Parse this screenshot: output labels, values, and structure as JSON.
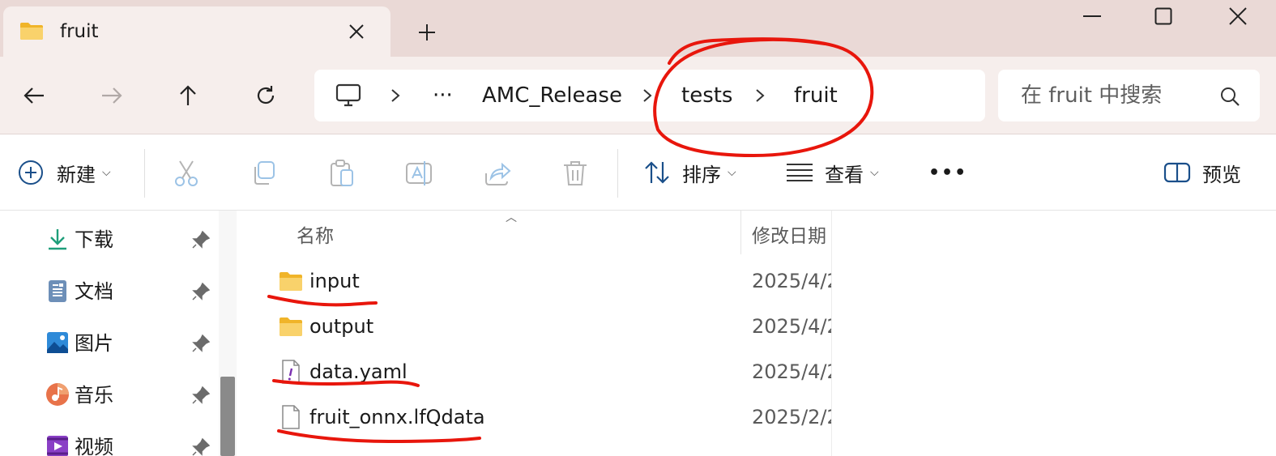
{
  "window": {
    "tab_title": "fruit",
    "new_tab_icon": "plus-icon",
    "minimize_icon": "minimize-icon",
    "maximize_icon": "maximize-icon",
    "close_icon": "close-icon"
  },
  "address_bar": {
    "root_icon": "computer-icon",
    "overflow": "···",
    "crumbs": [
      "AMC_Release",
      "tests",
      "fruit"
    ],
    "separator": ">"
  },
  "search": {
    "placeholder": "在 fruit 中搜索"
  },
  "toolbar": {
    "new_label": "新建",
    "sort_label": "排序",
    "view_label": "查看",
    "more_label": "•••",
    "preview_label": "预览",
    "disabled_actions": [
      "cut-icon",
      "copy-icon",
      "paste-icon",
      "rename-icon",
      "share-icon",
      "delete-icon"
    ]
  },
  "sidebar": {
    "items": [
      {
        "label": "下载",
        "icon": "download-icon"
      },
      {
        "label": "文档",
        "icon": "documents-icon"
      },
      {
        "label": "图片",
        "icon": "pictures-icon"
      },
      {
        "label": "音乐",
        "icon": "music-icon"
      },
      {
        "label": "视频",
        "icon": "videos-icon"
      }
    ]
  },
  "file_list": {
    "columns": [
      "名称",
      "修改日期"
    ],
    "rows": [
      {
        "name": "input",
        "type": "folder",
        "date": "2025/4/2"
      },
      {
        "name": "output",
        "type": "folder",
        "date": "2025/4/2"
      },
      {
        "name": "data.yaml",
        "type": "yaml",
        "date": "2025/4/2"
      },
      {
        "name": "fruit_onnx.lfQdata",
        "type": "file",
        "date": "2025/2/2"
      }
    ]
  },
  "colors": {
    "titlebar": "#ead9d6",
    "navbar": "#f6eeec",
    "annotation": "#e8160c",
    "folder": "#f7c948"
  }
}
